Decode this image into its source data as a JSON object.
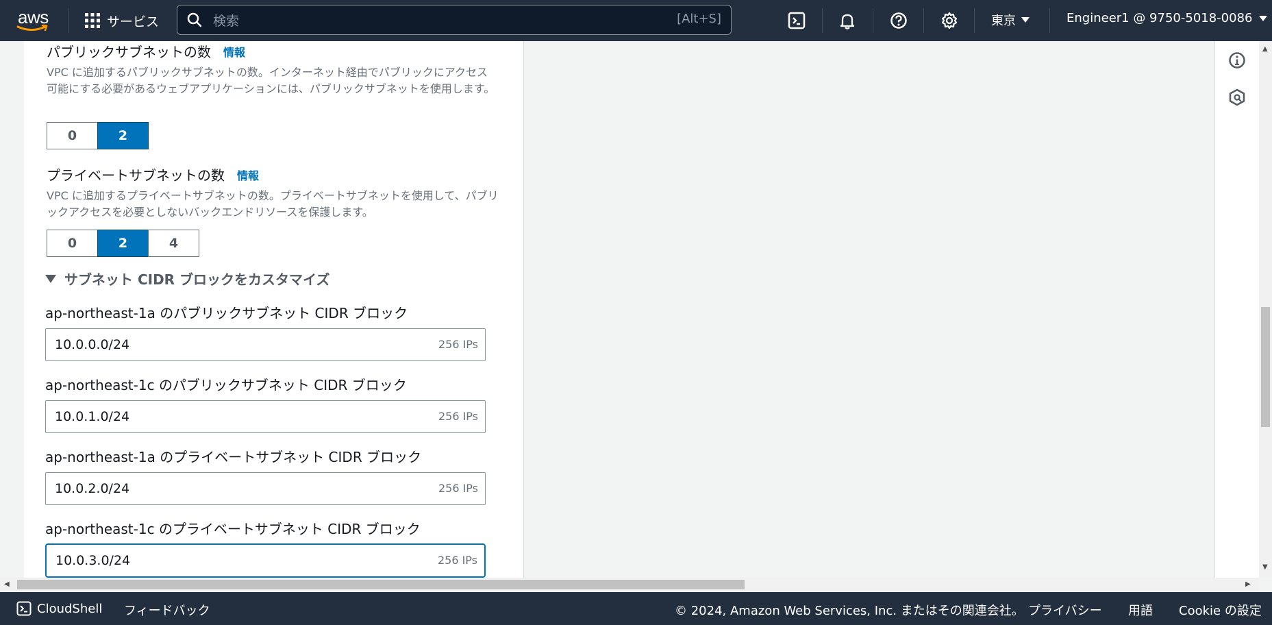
{
  "topnav": {
    "logo_text": "aws",
    "services_label": "サービス",
    "search_placeholder": "検索",
    "search_shortcut": "[Alt+S]",
    "icons": [
      "cloudshell-icon",
      "bell-icon",
      "help-icon",
      "settings-icon"
    ],
    "region_label": "東京",
    "account_label": "Engineer1 @ 9750-5018-0086"
  },
  "form": {
    "public_subnets": {
      "title": "パブリックサブネットの数",
      "info": "情報",
      "description": "VPC に追加するパブリックサブネットの数。インターネット経由でパブリックにアクセス可能にする必要があるウェブアプリケーションには、パブリックサブネットを使用します。",
      "options": [
        "0",
        "2"
      ],
      "selected": "2"
    },
    "private_subnets": {
      "title": "プライベートサブネットの数",
      "info": "情報",
      "description": "VPC に追加するプライベートサブネットの数。プライベートサブネットを使用して、パブリックアクセスを必要としないバックエンドリソースを保護します。",
      "options": [
        "0",
        "2",
        "4"
      ],
      "selected": "2"
    },
    "cidr_expander_label": "サブネット CIDR ブロックをカスタマイズ",
    "cidr_blocks": [
      {
        "label": "ap-northeast-1a のパブリックサブネット CIDR ブロック",
        "value": "10.0.0.0/24",
        "ips": "256 IPs"
      },
      {
        "label": "ap-northeast-1c のパブリックサブネット CIDR ブロック",
        "value": "10.0.1.0/24",
        "ips": "256 IPs"
      },
      {
        "label": "ap-northeast-1a のプライベートサブネット CIDR ブロック",
        "value": "10.0.2.0/24",
        "ips": "256 IPs"
      },
      {
        "label": "ap-northeast-1c のプライベートサブネット CIDR ブロック",
        "value": "10.0.3.0/24",
        "ips": "256 IPs"
      }
    ]
  },
  "footer": {
    "cloudshell": "CloudShell",
    "feedback": "フィードバック",
    "copyright": "© 2024, Amazon Web Services, Inc. またはその関連会社。",
    "privacy": "プライバシー",
    "terms": "用語",
    "cookie": "Cookie の設定"
  },
  "colors": {
    "nav_bg": "#232f3e",
    "accent": "#0073bb",
    "page_bg": "#f2f3f3"
  }
}
